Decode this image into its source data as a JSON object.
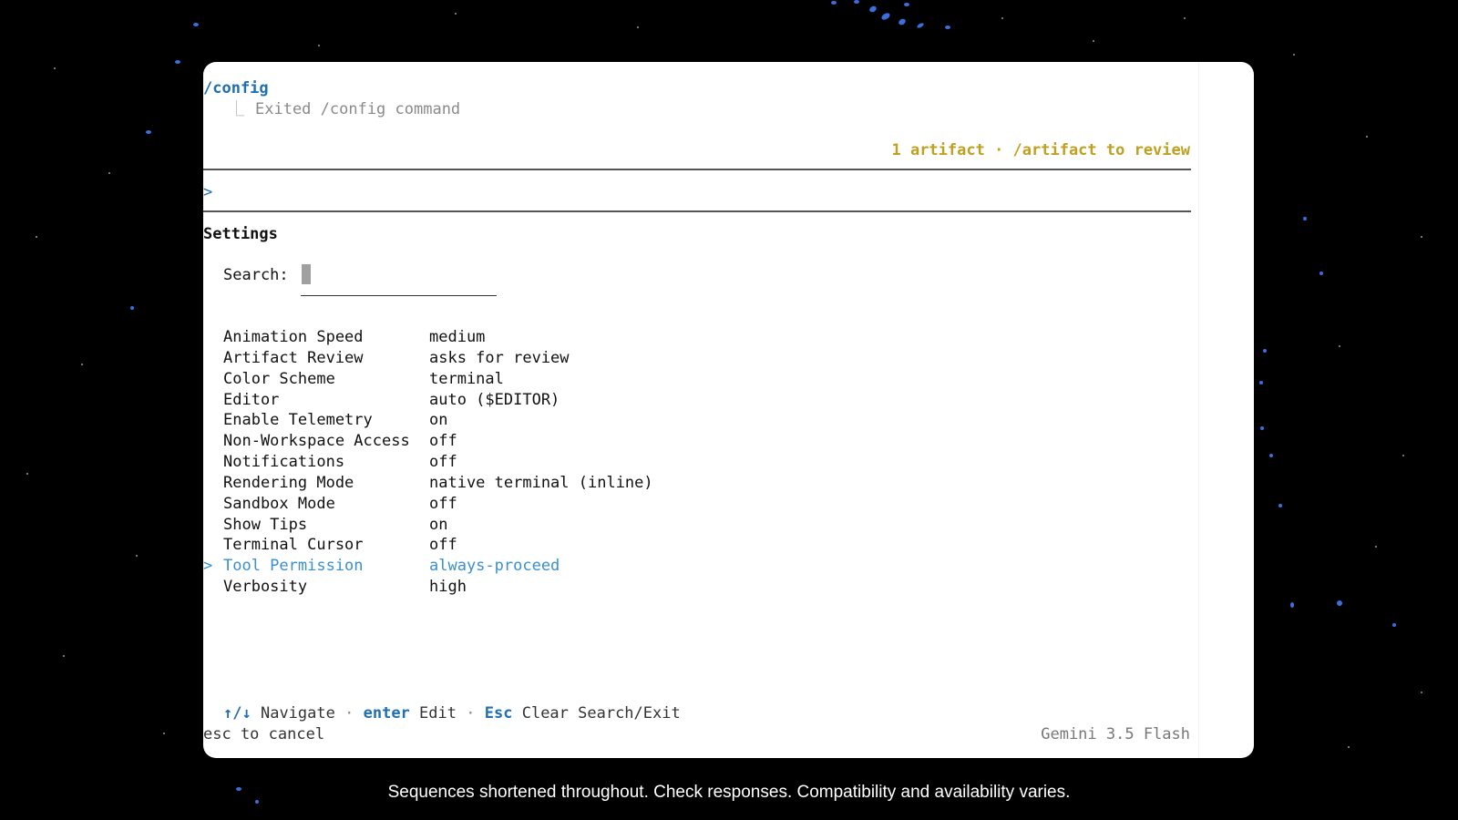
{
  "terminal": {
    "command": "/config",
    "branch_glyph": "⎿",
    "exited_message": "Exited /config command",
    "artifact_notice": "1 artifact · /artifact to review",
    "prompt_symbol": ">",
    "settings_title": "Settings",
    "search_label": "Search:",
    "search_value": "",
    "settings": [
      {
        "name": "Animation Speed",
        "value": "medium",
        "selected": false
      },
      {
        "name": "Artifact Review",
        "value": "asks for review",
        "selected": false
      },
      {
        "name": "Color Scheme",
        "value": "terminal",
        "selected": false
      },
      {
        "name": "Editor",
        "value": "auto ($EDITOR)",
        "selected": false
      },
      {
        "name": "Enable Telemetry",
        "value": "on",
        "selected": false
      },
      {
        "name": "Non-Workspace Access",
        "value": "off",
        "selected": false
      },
      {
        "name": "Notifications",
        "value": "off",
        "selected": false
      },
      {
        "name": "Rendering Mode",
        "value": "native terminal (inline)",
        "selected": false
      },
      {
        "name": "Sandbox Mode",
        "value": "off",
        "selected": false
      },
      {
        "name": "Show Tips",
        "value": "on",
        "selected": false
      },
      {
        "name": "Terminal Cursor",
        "value": "off",
        "selected": false
      },
      {
        "name": "Tool Permission",
        "value": "always-proceed",
        "selected": true
      },
      {
        "name": "Verbosity",
        "value": "high",
        "selected": false
      }
    ],
    "selection_marker": ">",
    "help": {
      "nav_key": "↑/↓",
      "nav_label": "Navigate",
      "separator": "·",
      "edit_key": "enter",
      "edit_label": "Edit",
      "exit_key": "Esc",
      "exit_label": "Clear Search/Exit"
    },
    "cancel_hint": "esc to cancel",
    "model_name": "Gemini 3.5 Flash"
  },
  "caption": "Sequences shortened throughout. Check responses. Compatibility and availability varies.",
  "colors": {
    "accent_blue": "#1f6fb5",
    "selected_blue": "#3a8fd0",
    "artifact_yellow": "#c0a020",
    "background": "#000000"
  }
}
